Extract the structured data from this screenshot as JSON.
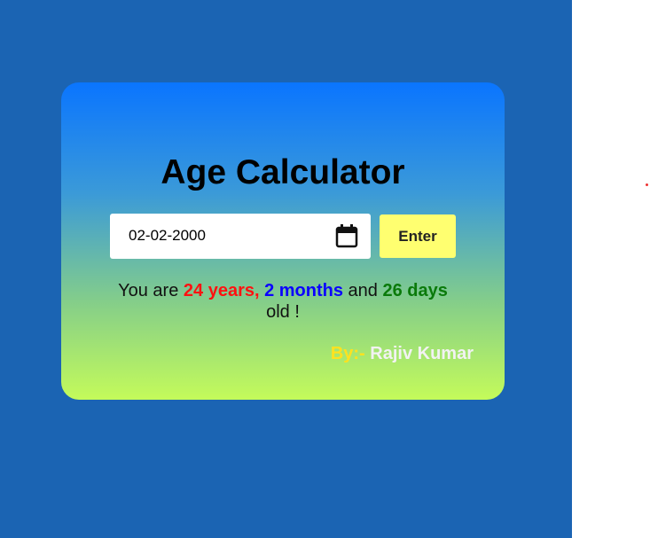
{
  "app": {
    "title": "Age Calculator"
  },
  "form": {
    "date_value": "02-02-2000",
    "enter_label": "Enter"
  },
  "result": {
    "prefix": "You are ",
    "years": "24 years,",
    "sep1": " ",
    "months": "2 months",
    "and": " and ",
    "days": "26 days",
    "line2": "old !"
  },
  "byline": {
    "by": "By:-",
    "name": "Rajiv Kumar"
  },
  "colors": {
    "background": "#1b64b3",
    "card_top": "#0a75ff",
    "card_bottom": "#c4fb5a",
    "button": "#ffff70",
    "years": "#ff1111",
    "months": "#0a00ff",
    "days": "#0a7a0a",
    "by": "#ffe21f"
  },
  "icons": {
    "date_picker": "calendar-icon"
  }
}
